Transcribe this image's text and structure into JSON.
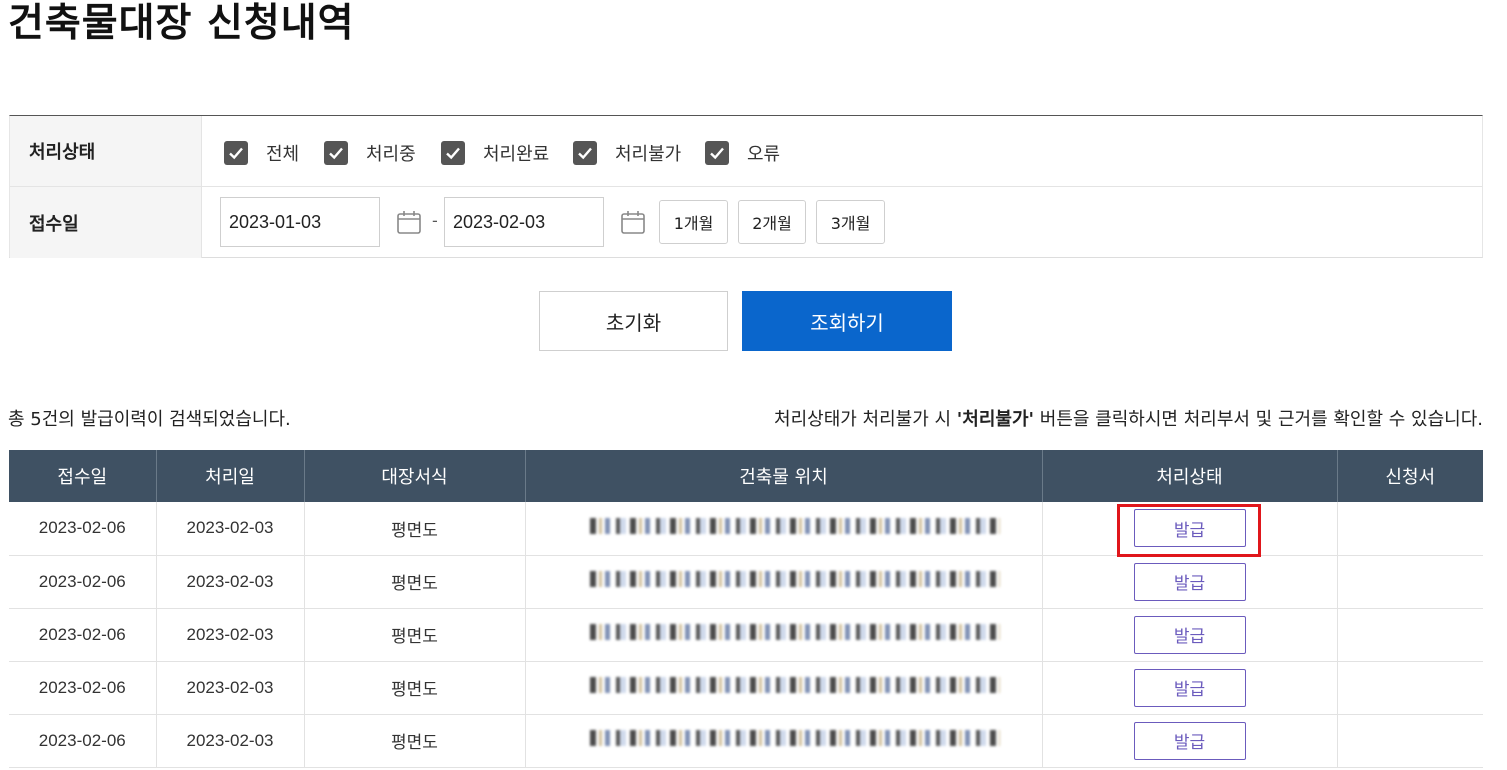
{
  "page": {
    "title": "건축물대장 신청내역"
  },
  "filter": {
    "status_label": "처리상태",
    "status_options": [
      {
        "label": "전체",
        "checked": true
      },
      {
        "label": "처리중",
        "checked": true
      },
      {
        "label": "처리완료",
        "checked": true
      },
      {
        "label": "처리불가",
        "checked": true
      },
      {
        "label": "오류",
        "checked": true
      }
    ],
    "date_label": "접수일",
    "date_from": "2023-01-03",
    "date_to": "2023-02-03",
    "date_separator": "-",
    "periods": [
      "1개월",
      "2개월",
      "3개월"
    ]
  },
  "buttons": {
    "reset": "초기화",
    "search": "조회하기"
  },
  "results": {
    "count_text": "총 5건의 발급이력이 검색되었습니다.",
    "notice_prefix": "처리상태가 처리불가 시 ",
    "notice_bold": "'처리불가'",
    "notice_suffix": " 버튼을 클릭하시면 처리부서 및 근거를 확인할 수 있습니다."
  },
  "table": {
    "headers": [
      "접수일",
      "처리일",
      "대장서식",
      "건축물 위치",
      "처리상태",
      "신청서"
    ],
    "rows": [
      {
        "received": "2023-02-06",
        "processed": "2023-02-03",
        "form": "평면도",
        "status": "발급"
      },
      {
        "received": "2023-02-06",
        "processed": "2023-02-03",
        "form": "평면도",
        "status": "발급"
      },
      {
        "received": "2023-02-06",
        "processed": "2023-02-03",
        "form": "평면도",
        "status": "발급"
      },
      {
        "received": "2023-02-06",
        "processed": "2023-02-03",
        "form": "평면도",
        "status": "발급"
      },
      {
        "received": "2023-02-06",
        "processed": "2023-02-03",
        "form": "평면도",
        "status": "발급"
      }
    ]
  },
  "colors": {
    "header_bg": "#3f5163",
    "primary": "#0a66cc",
    "issue_button": "#6b5bbd",
    "highlight": "#e0161b"
  }
}
